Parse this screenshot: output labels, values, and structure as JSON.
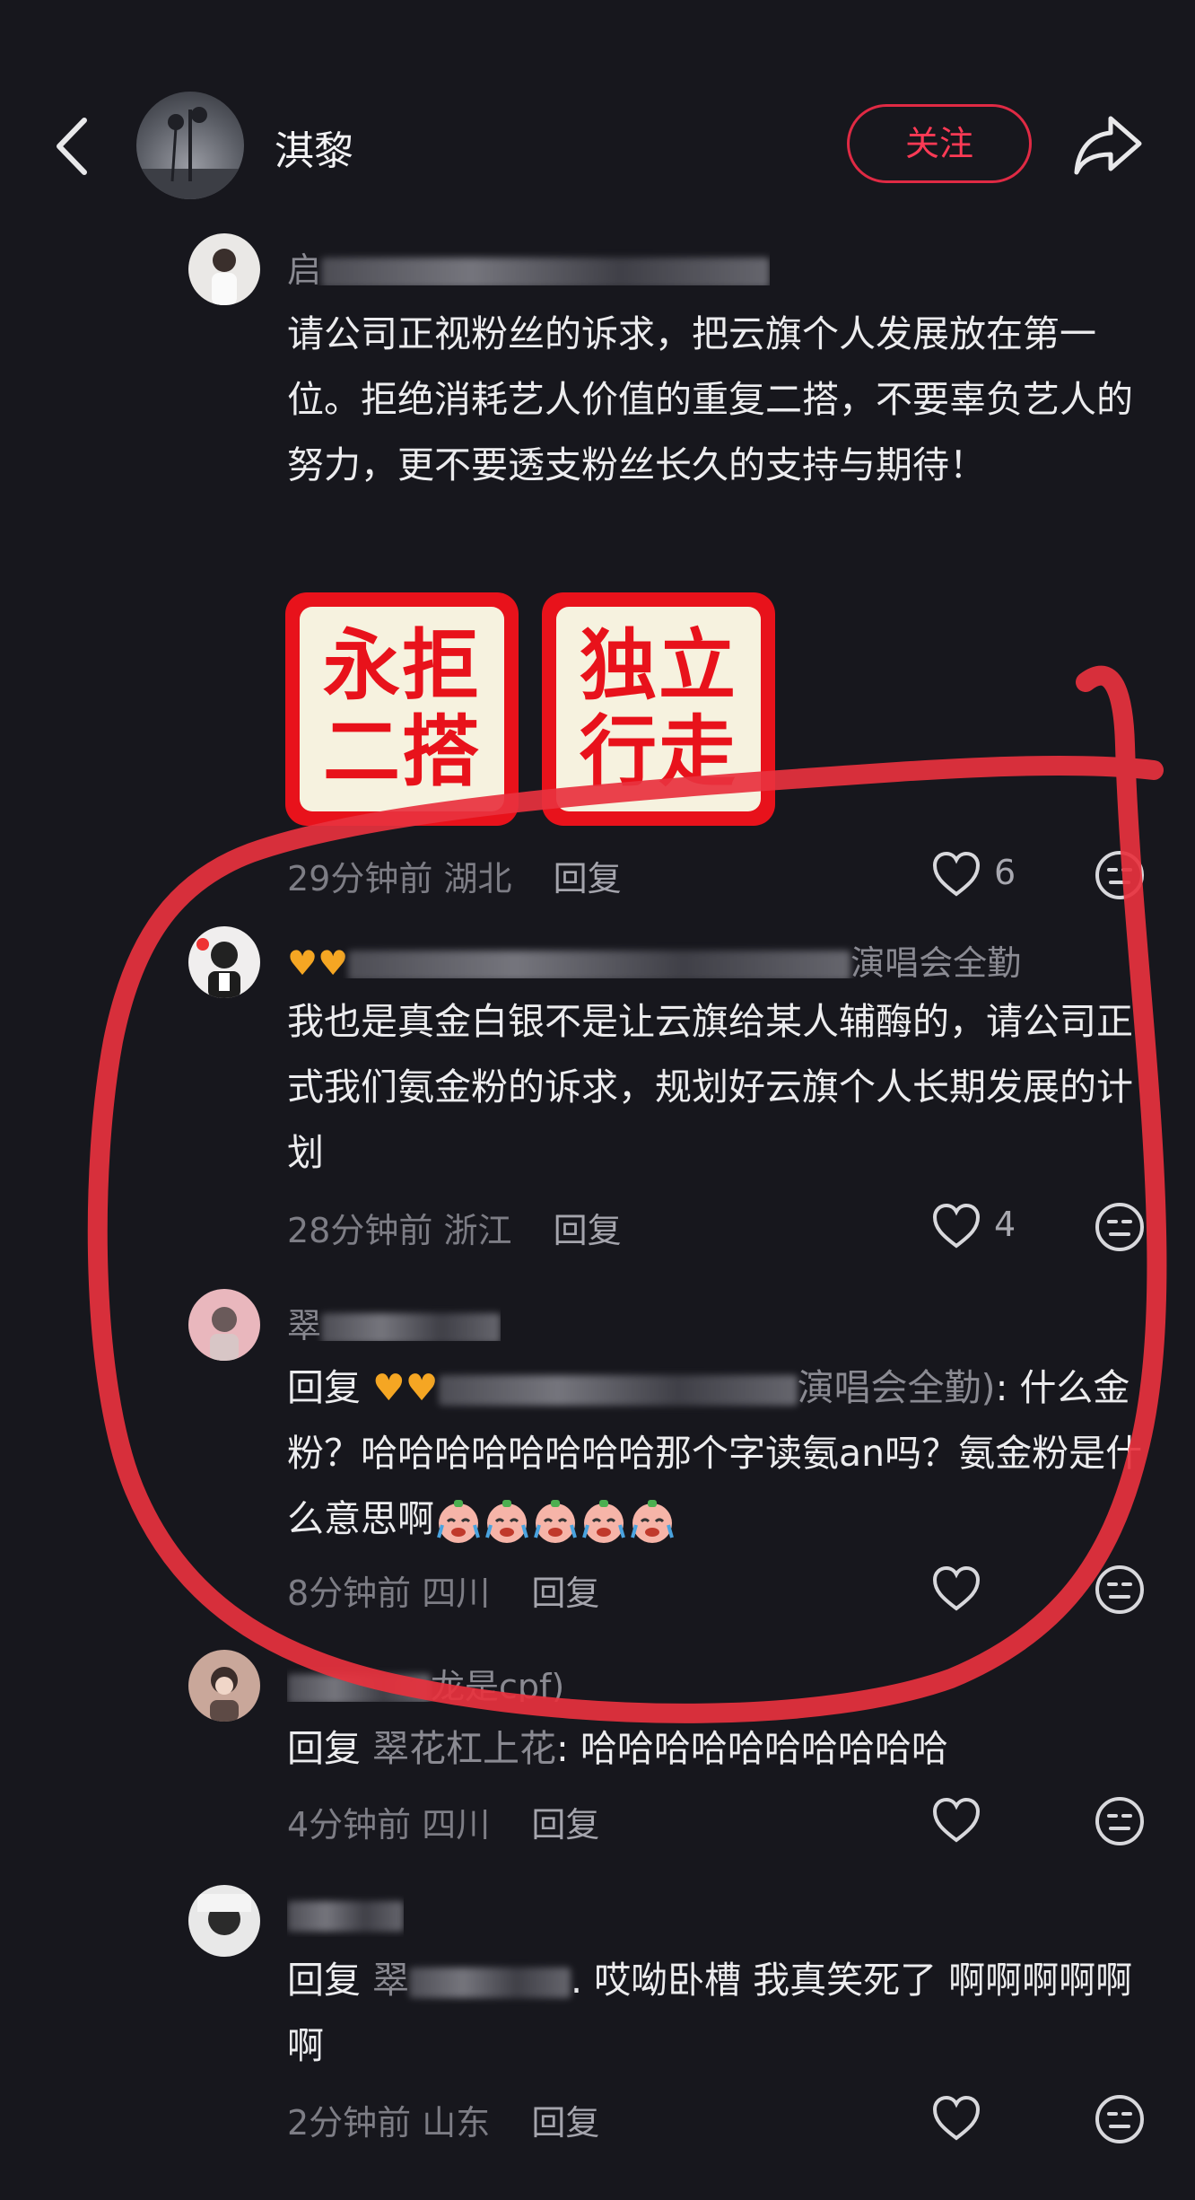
{
  "header": {
    "title": "淇黎",
    "follow_label": "关注"
  },
  "comments": [
    {
      "username": "启",
      "text": "请公司正视粉丝的诉求，把云旗个人发展放在第一位。拒绝消耗艺人价值的重复二搭，不要辜负艺人的努力，更不要透支粉丝长久的支持与期待！",
      "stickers": [
        {
          "line1": "永拒",
          "line2": "二搭"
        },
        {
          "line1": "独立",
          "line2": "行走"
        }
      ],
      "time": "29分钟前",
      "location": "湖北",
      "reply_label": "回复",
      "likes": "6"
    },
    {
      "username_suffix": "演唱会全勤",
      "text": "我也是真金白银不是让云旗给某人辅酶的，请公司正式我们氨金粉的诉求，规划好云旗个人长期发展的计划",
      "time": "28分钟前",
      "location": "浙江",
      "reply_label": "回复",
      "likes": "4"
    },
    {
      "username": "翠",
      "reply_prefix": "回复",
      "reply_target_suffix": "演唱会全勤)",
      "text": ": 什么金粉？哈哈哈哈哈哈哈哈那个字读氨an吗？氨金粉是什么意思啊",
      "time": "8分钟前",
      "location": "四川",
      "reply_label": "回复"
    },
    {
      "username_suffix": "龙是cpf)",
      "reply_prefix": "回复",
      "reply_target": "翠花杠上花",
      "text": ": 哈哈哈哈哈哈哈哈哈哈",
      "time": "4分钟前",
      "location": "四川",
      "reply_label": "回复"
    },
    {
      "reply_prefix": "回复",
      "reply_target": "翠",
      "text": ". 哎呦卧槽 我真笑死了  啊啊啊啊啊啊",
      "time": "2分钟前",
      "location": "山东",
      "reply_label": "回复"
    }
  ],
  "colors": {
    "background": "#17171d",
    "accent": "#ff3a55",
    "annotation_red": "#e8323e"
  },
  "icons": [
    "back-arrow-icon",
    "share-icon",
    "heart-icon",
    "dislike-face-icon",
    "crying-laughing-emoji"
  ]
}
